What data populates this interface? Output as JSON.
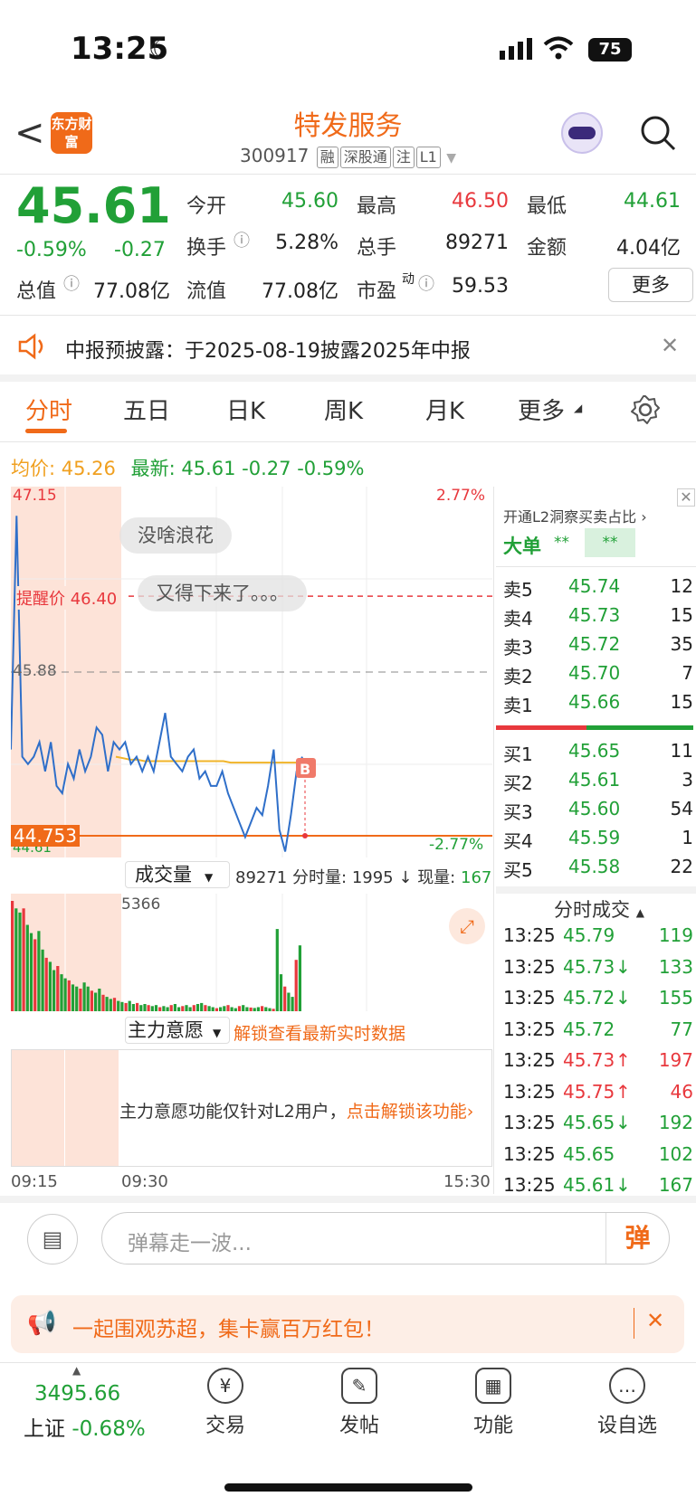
{
  "status": {
    "time": "13:25",
    "battery": "75"
  },
  "header": {
    "back_label": "<",
    "logo_text": "东方财富",
    "title": "特发服务",
    "code": "300917",
    "tags": [
      "融",
      "深股通",
      "注",
      "L1"
    ]
  },
  "quote": {
    "price": "45.61",
    "change_pct": "-0.59%",
    "change": "-0.27",
    "open_label": "今开",
    "open": "45.60",
    "high_label": "最高",
    "high": "46.50",
    "low_label": "最低",
    "low": "44.61",
    "turnover_label": "换手",
    "turnover": "5.28%",
    "volume_label": "总手",
    "volume": "89271",
    "amount_label": "金额",
    "amount": "4.04亿",
    "mcap_label": "总值",
    "mcap": "77.08亿",
    "float_label": "流值",
    "float_cap": "77.08亿",
    "pe_label": "市盈",
    "pe_sup": "动",
    "pe": "59.53",
    "more_label": "更多"
  },
  "notice": {
    "text": "中报预披露：于2025-08-19披露2025年中报"
  },
  "tabs": [
    {
      "label": "分时",
      "active": true
    },
    {
      "label": "五日",
      "active": false
    },
    {
      "label": "日K",
      "active": false
    },
    {
      "label": "周K",
      "active": false
    },
    {
      "label": "月K",
      "active": false
    },
    {
      "label": "更多",
      "active": false
    }
  ],
  "info_bar": {
    "avg_label": "均价:",
    "avg": "45.26",
    "latest_label": "最新:",
    "latest": "45.61",
    "latest_change": "-0.27",
    "latest_pct": "-0.59%"
  },
  "chart_data": {
    "type": "line",
    "y_top_label": "47.15",
    "y_top_pct": "2.77%",
    "y_mid_label": "45.88",
    "y_bottom_label": "44.61",
    "y_bottom_pct": "-2.77%",
    "alert_label": "提醒价 46.40",
    "alert_value": 46.4,
    "cursor_label": "44.753",
    "ylim": [
      44.61,
      47.15
    ],
    "x_labels": [
      "09:15",
      "09:30",
      "15:30"
    ],
    "price_series": [
      45.35,
      46.95,
      45.3,
      45.25,
      45.3,
      45.4,
      45.2,
      45.4,
      45.1,
      45.05,
      45.25,
      45.15,
      45.35,
      45.2,
      45.3,
      45.5,
      45.45,
      45.2,
      45.4,
      45.35,
      45.4,
      45.25,
      45.3,
      45.2,
      45.3,
      45.2,
      45.4,
      45.6,
      45.3,
      45.25,
      45.2,
      45.3,
      45.35,
      45.15,
      45.2,
      45.1,
      45.1,
      45.2,
      45.05,
      44.95,
      44.85,
      44.75,
      44.85,
      44.95,
      44.9,
      45.1,
      45.35,
      44.8,
      44.65,
      44.9,
      45.2,
      45.3
    ],
    "avg_series": [
      45.3,
      45.29,
      45.28,
      45.28,
      45.27,
      45.27,
      45.27,
      45.27,
      45.27,
      45.27,
      45.27,
      45.27,
      45.27,
      45.27,
      45.27,
      45.27,
      45.26,
      45.26,
      45.26,
      45.26,
      45.26,
      45.26,
      45.26,
      45.26,
      45.26,
      45.26,
      45.26
    ],
    "volume_label": "成交量",
    "volume_total": "89271",
    "minute_vol_label": "分时量:",
    "minute_vol": "1995",
    "now_vol_label": "现量:",
    "now_vol": "167",
    "volume_peak": "5366",
    "volume_bars": [
      5366,
      5000,
      4800,
      5000,
      4200,
      3800,
      3500,
      3900,
      3000,
      2600,
      2400,
      2000,
      2200,
      1800,
      1600,
      1500,
      1300,
      1200,
      1100,
      1400,
      1200,
      1000,
      900,
      1100,
      800,
      700,
      600,
      650,
      500,
      450,
      400,
      500,
      350,
      400,
      300,
      350,
      300,
      250,
      300,
      200,
      250,
      200,
      300,
      350,
      200,
      250,
      300,
      200,
      300,
      350,
      400,
      300,
      250,
      200,
      150,
      200,
      250,
      300,
      200,
      150,
      250,
      300,
      200,
      180,
      160,
      200,
      250,
      200,
      150,
      120,
      4000,
      1800,
      1200,
      900,
      700,
      2500,
      3200
    ]
  },
  "bubbles": [
    "没啥浪花",
    "又得下来了。。。"
  ],
  "l2": {
    "title": "开通L2洞察买卖占比",
    "big_order_label": "大单",
    "big1": "**",
    "big2": "**"
  },
  "order_book": {
    "asks": [
      {
        "label": "卖5",
        "price": "45.74",
        "vol": "12"
      },
      {
        "label": "卖4",
        "price": "45.73",
        "vol": "15"
      },
      {
        "label": "卖3",
        "price": "45.72",
        "vol": "35"
      },
      {
        "label": "卖2",
        "price": "45.70",
        "vol": "7"
      },
      {
        "label": "卖1",
        "price": "45.66",
        "vol": "15"
      }
    ],
    "bids": [
      {
        "label": "买1",
        "price": "45.65",
        "vol": "11"
      },
      {
        "label": "买2",
        "price": "45.61",
        "vol": "3"
      },
      {
        "label": "买3",
        "price": "45.60",
        "vol": "54"
      },
      {
        "label": "买4",
        "price": "45.59",
        "vol": "1"
      },
      {
        "label": "买5",
        "price": "45.58",
        "vol": "22"
      }
    ]
  },
  "ticks_title": "分时成交",
  "ticks": [
    {
      "time": "13:25",
      "price": "45.79",
      "arrow": "",
      "vol": "119",
      "color": "green"
    },
    {
      "time": "13:25",
      "price": "45.73",
      "arrow": "↓",
      "vol": "133",
      "color": "green"
    },
    {
      "time": "13:25",
      "price": "45.72",
      "arrow": "↓",
      "vol": "155",
      "color": "green"
    },
    {
      "time": "13:25",
      "price": "45.72",
      "arrow": "",
      "vol": "77",
      "color": "green"
    },
    {
      "time": "13:25",
      "price": "45.73",
      "arrow": "↑",
      "vol": "197",
      "color": "red"
    },
    {
      "time": "13:25",
      "price": "45.75",
      "arrow": "↑",
      "vol": "46",
      "color": "red"
    },
    {
      "time": "13:25",
      "price": "45.65",
      "arrow": "↓",
      "vol": "192",
      "color": "green"
    },
    {
      "time": "13:25",
      "price": "45.65",
      "arrow": "",
      "vol": "102",
      "color": "green"
    },
    {
      "time": "13:25",
      "price": "45.61",
      "arrow": "↓",
      "vol": "167",
      "color": "green"
    }
  ],
  "main_force": {
    "label": "主力意愿",
    "unlock_text": "解锁查看最新实时数据",
    "desc": "主力意愿功能仅针对L2用户，",
    "link": "点击解锁该功能"
  },
  "danmu": {
    "placeholder": "弹幕走一波...",
    "button": "弹"
  },
  "promo": {
    "text": "一起围观苏超，集卡赢百万红包！"
  },
  "bottom_nav": {
    "index_value": "3495.66",
    "index_name": "上证",
    "index_change": "-0.68%",
    "items": [
      {
        "label": "交易",
        "icon": "¥"
      },
      {
        "label": "发帖",
        "icon": "✎"
      },
      {
        "label": "功能",
        "icon": "▦"
      },
      {
        "label": "设自选",
        "icon": "…"
      }
    ]
  },
  "colors": {
    "accent": "#f06a19",
    "up": "#e8383d",
    "down": "#21a037",
    "avg_line": "#f0b429",
    "price_line": "#2f6fc9"
  }
}
